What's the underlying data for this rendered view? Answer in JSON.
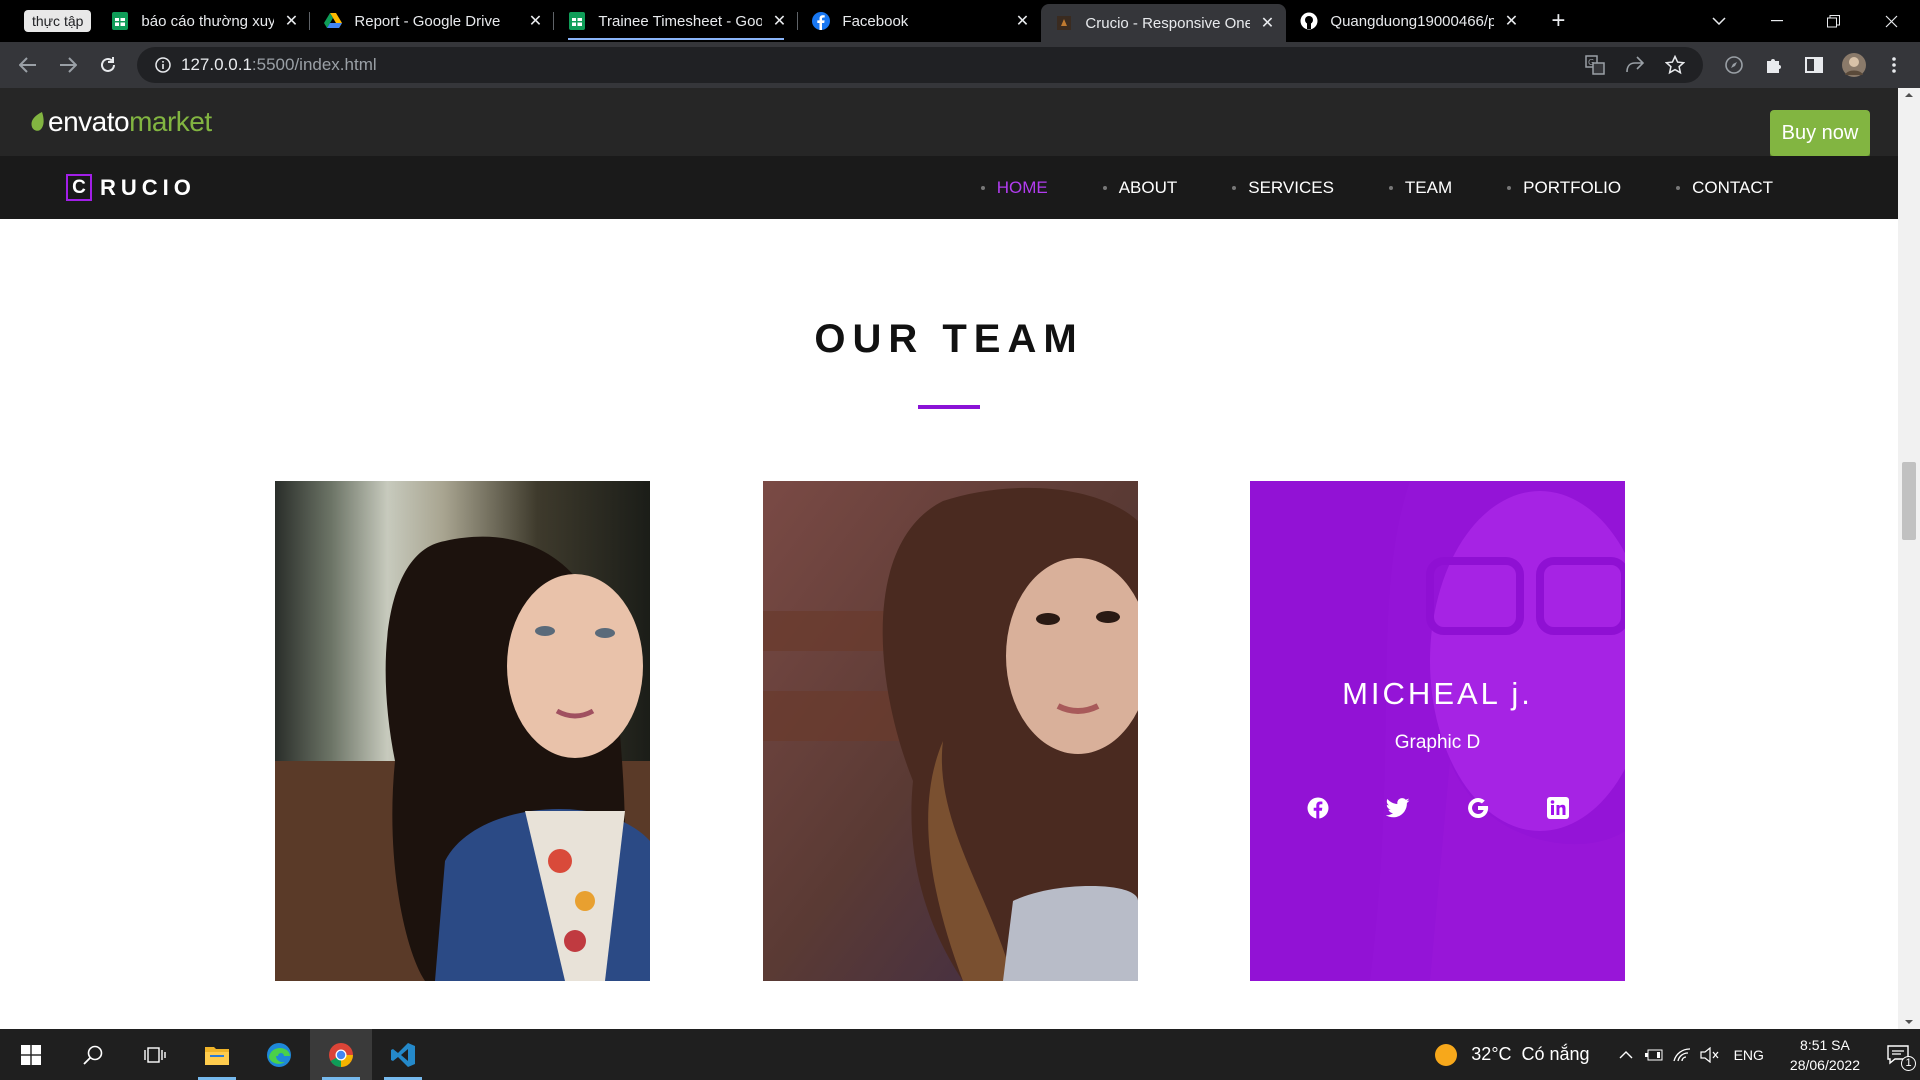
{
  "browser": {
    "tab_group_label": "thực tập",
    "tabs": [
      {
        "title": "báo cáo thường xuyên th",
        "icon": "google-sheets-icon",
        "active": false
      },
      {
        "title": "Report - Google Drive",
        "icon": "google-drive-icon",
        "active": false
      },
      {
        "title": "Trainee Timesheet - Goo",
        "icon": "google-sheets-icon",
        "active": false
      },
      {
        "title": "Facebook",
        "icon": "facebook-icon",
        "active": false
      },
      {
        "title": "Crucio - Responsive One",
        "icon": "crucio-favicon",
        "active": true
      },
      {
        "title": "Quangduong19000466/p",
        "icon": "github-icon",
        "active": false
      }
    ],
    "new_tab": "+",
    "url_host": "127.0.0.1",
    "url_rest": ":5500/index.html"
  },
  "envato": {
    "logo_envato": "envato",
    "logo_market": "market",
    "buy_label": "Buy now"
  },
  "site": {
    "brand_letter": "C",
    "brand_rest": "RUCIO",
    "nav": [
      "HOME",
      "ABOUT",
      "SERVICES",
      "TEAM",
      "PORTFOLIO",
      "CONTACT"
    ],
    "nav_active": "HOME"
  },
  "team": {
    "heading": "OUR TEAM",
    "members": [
      {
        "name": "",
        "role": "",
        "hovered": false
      },
      {
        "name": "",
        "role": "",
        "hovered": false
      },
      {
        "name": "MICHEAL j.",
        "role": "Graphic D",
        "hovered": true
      }
    ],
    "social_icons": [
      "facebook-icon",
      "twitter-icon",
      "google-icon",
      "linkedin-icon"
    ]
  },
  "taskbar": {
    "weather_temp": "32°C",
    "weather_text": "Có nắng",
    "language": "ENG",
    "time": "8:51 SA",
    "date": "28/06/2022",
    "notification_count": "1"
  },
  "colors": {
    "accent_purple": "#a010ee",
    "envato_green": "#82b541",
    "nav_bg": "#1a1a1a"
  }
}
